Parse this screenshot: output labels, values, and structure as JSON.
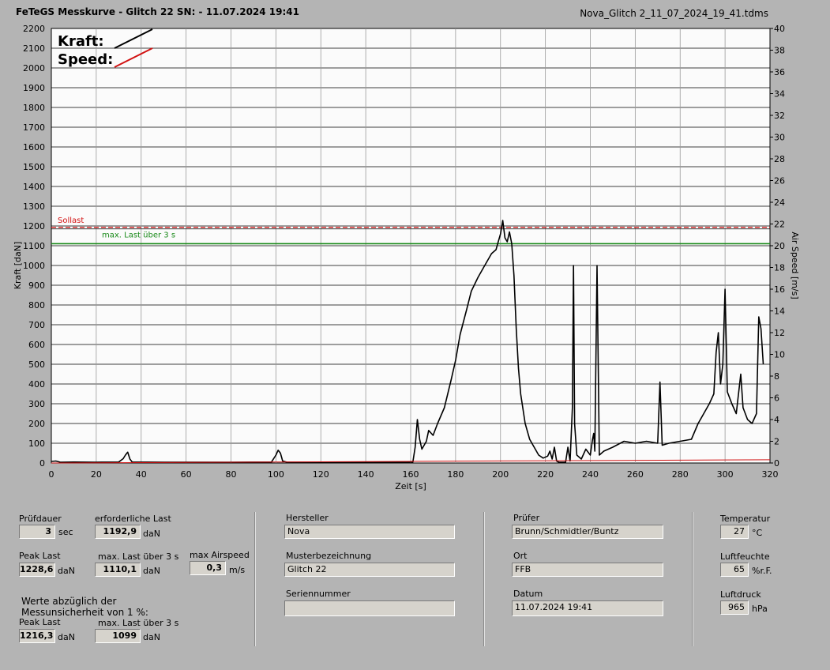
{
  "header": {
    "title": "FeTeGS Messkurve - Glitch 22  SN:  - 11.07.2024 19:41",
    "filename": "Nova_Glitch 2_11_07_2024_19_41.tdms"
  },
  "chart_data": {
    "type": "line",
    "xlabel": "Zeit [s]",
    "ylabel": "Kraft [daN]",
    "y2label": "Air Speed [m/s]",
    "xlim": [
      0,
      320
    ],
    "ylim": [
      0,
      2200
    ],
    "y2lim": [
      0,
      40
    ],
    "x_ticks": [
      0,
      20,
      40,
      60,
      80,
      100,
      120,
      140,
      160,
      180,
      200,
      220,
      240,
      260,
      280,
      300,
      320
    ],
    "y_ticks": [
      0,
      100,
      200,
      300,
      400,
      500,
      600,
      700,
      800,
      900,
      1000,
      1100,
      1200,
      1300,
      1400,
      1500,
      1600,
      1700,
      1800,
      1900,
      2000,
      2100,
      2200
    ],
    "y2_ticks": [
      0,
      2,
      4,
      6,
      8,
      10,
      12,
      14,
      16,
      18,
      20,
      22,
      24,
      26,
      28,
      30,
      32,
      34,
      36,
      38,
      40
    ],
    "grid": true,
    "legend": {
      "placement": "top-left",
      "entries": [
        {
          "label": "Kraft:",
          "color": "#000000"
        },
        {
          "label": "Speed:",
          "color": "#d11111"
        }
      ]
    },
    "reference_lines": [
      {
        "label": "Sollast",
        "y": 1192.9,
        "color": "#d11111",
        "style": "dashed"
      },
      {
        "label": "max. Last über  3 s",
        "y": 1110.1,
        "color": "#1a8a1a",
        "style": "solid"
      }
    ],
    "series": [
      {
        "name": "Kraft",
        "color": "#000000",
        "points": [
          [
            0,
            8
          ],
          [
            2,
            10
          ],
          [
            4,
            4
          ],
          [
            10,
            5
          ],
          [
            20,
            4
          ],
          [
            30,
            5
          ],
          [
            32,
            22
          ],
          [
            33,
            40
          ],
          [
            34,
            55
          ],
          [
            35,
            20
          ],
          [
            36,
            5
          ],
          [
            50,
            4
          ],
          [
            80,
            4
          ],
          [
            98,
            5
          ],
          [
            100,
            40
          ],
          [
            101,
            65
          ],
          [
            102,
            50
          ],
          [
            103,
            10
          ],
          [
            105,
            4
          ],
          [
            130,
            3
          ],
          [
            155,
            3
          ],
          [
            161,
            5
          ],
          [
            162,
            80
          ],
          [
            163,
            220
          ],
          [
            164,
            120
          ],
          [
            165,
            70
          ],
          [
            167,
            110
          ],
          [
            168,
            165
          ],
          [
            170,
            140
          ],
          [
            172,
            200
          ],
          [
            175,
            280
          ],
          [
            178,
            420
          ],
          [
            180,
            520
          ],
          [
            182,
            650
          ],
          [
            185,
            780
          ],
          [
            187,
            870
          ],
          [
            190,
            940
          ],
          [
            193,
            1000
          ],
          [
            196,
            1060
          ],
          [
            198,
            1080
          ],
          [
            199,
            1120
          ],
          [
            200,
            1160
          ],
          [
            201,
            1228
          ],
          [
            202,
            1140
          ],
          [
            203,
            1120
          ],
          [
            204,
            1170
          ],
          [
            205,
            1110
          ],
          [
            206,
            950
          ],
          [
            207,
            680
          ],
          [
            208,
            480
          ],
          [
            209,
            350
          ],
          [
            211,
            200
          ],
          [
            213,
            120
          ],
          [
            215,
            80
          ],
          [
            217,
            40
          ],
          [
            219,
            25
          ],
          [
            221,
            35
          ],
          [
            222,
            60
          ],
          [
            223,
            20
          ],
          [
            224,
            80
          ],
          [
            225,
            10
          ],
          [
            226,
            4
          ],
          [
            229,
            4
          ],
          [
            230,
            80
          ],
          [
            231,
            10
          ],
          [
            232,
            280
          ],
          [
            232.5,
            1000
          ],
          [
            233,
            200
          ],
          [
            234,
            40
          ],
          [
            236,
            20
          ],
          [
            238,
            70
          ],
          [
            240,
            40
          ],
          [
            241,
            120
          ],
          [
            241.5,
            150
          ],
          [
            242,
            60
          ],
          [
            243,
            1000
          ],
          [
            244,
            40
          ],
          [
            246,
            60
          ],
          [
            250,
            80
          ],
          [
            255,
            110
          ],
          [
            260,
            100
          ],
          [
            265,
            110
          ],
          [
            270,
            100
          ],
          [
            271,
            410
          ],
          [
            272,
            90
          ],
          [
            275,
            100
          ],
          [
            280,
            110
          ],
          [
            285,
            120
          ],
          [
            288,
            200
          ],
          [
            290,
            240
          ],
          [
            293,
            300
          ],
          [
            295,
            350
          ],
          [
            296,
            560
          ],
          [
            297,
            660
          ],
          [
            298,
            400
          ],
          [
            299,
            500
          ],
          [
            300,
            880
          ],
          [
            301,
            360
          ],
          [
            303,
            300
          ],
          [
            305,
            250
          ],
          [
            307,
            450
          ],
          [
            308,
            280
          ],
          [
            310,
            220
          ],
          [
            312,
            200
          ],
          [
            314,
            250
          ],
          [
            315,
            740
          ],
          [
            316,
            680
          ],
          [
            317,
            500
          ]
        ]
      },
      {
        "name": "Speed",
        "color": "#d11111",
        "points": [
          [
            0,
            0
          ],
          [
            320,
            0.3
          ]
        ]
      }
    ]
  },
  "stats": {
    "pruefdauer": {
      "label": "Prüfdauer",
      "value": "3",
      "unit": "sec"
    },
    "erforderliche_last": {
      "label": "erforderliche Last",
      "value": "1192,9",
      "unit": "daN"
    },
    "peak_last": {
      "label": "Peak Last",
      "value": "1228,6",
      "unit": "daN"
    },
    "max_last": {
      "label": "max. Last über  3 s",
      "value": "1110,1",
      "unit": "daN"
    },
    "max_airspeed": {
      "label": "max Airspeed",
      "value": "0,3",
      "unit": "m/s"
    },
    "note_line1": "Werte abzüglich der",
    "note_line2": "Messunsicherheit von 1  %:",
    "peak_last_adj": {
      "label": "Peak Last",
      "value": "1216,3",
      "unit": "daN"
    },
    "max_last_adj": {
      "label": "max. Last über  3 s",
      "value": "1099",
      "unit": "daN"
    }
  },
  "info": {
    "hersteller": {
      "label": "Hersteller",
      "value": "Nova"
    },
    "musterbezeichnung": {
      "label": "Musterbezeichnung",
      "value": "Glitch 22"
    },
    "seriennummer": {
      "label": "Seriennummer",
      "value": ""
    },
    "pruefer": {
      "label": "Prüfer",
      "value": "Brunn/Schmidtler/Buntz"
    },
    "ort": {
      "label": "Ort",
      "value": "FFB"
    },
    "datum": {
      "label": "Datum",
      "value": "11.07.2024 19:41"
    }
  },
  "env": {
    "temperatur": {
      "label": "Temperatur",
      "value": "27",
      "unit": "°C"
    },
    "luftfeuchte": {
      "label": "Luftfeuchte",
      "value": "65",
      "unit": "%r.F."
    },
    "luftdruck": {
      "label": "Luftdruck",
      "value": "965",
      "unit": "hPa"
    }
  }
}
